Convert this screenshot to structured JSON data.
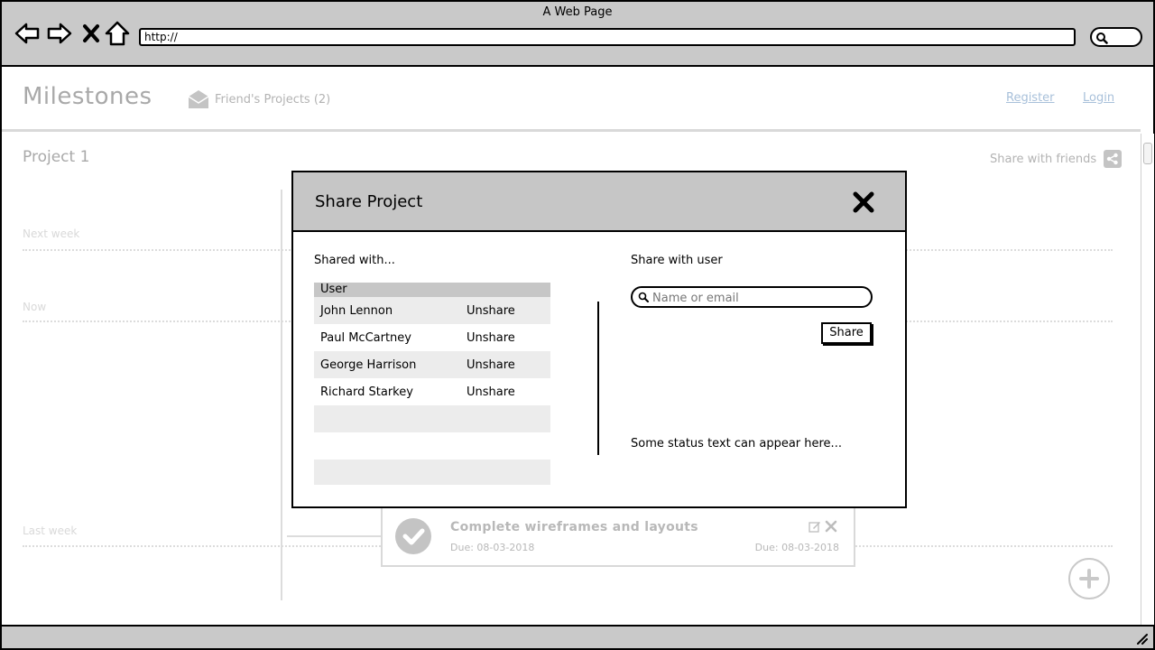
{
  "window": {
    "title": "A Web Page",
    "url": "http://"
  },
  "app": {
    "brand": "Milestones",
    "friends_projects": "Friend's Projects (2)",
    "register": "Register",
    "login": "Login"
  },
  "project": {
    "title": "Project 1",
    "share_with_friends": "Share with friends",
    "timeline_labels": {
      "next_week": "Next week",
      "now": "Now",
      "last_week": "Last week"
    }
  },
  "task": {
    "title": "Complete wireframes and layouts",
    "due_left": "Due: 08-03-2018",
    "due_right": "Due: 08-03-2018"
  },
  "modal": {
    "title": "Share Project",
    "shared_with_label": "Shared with...",
    "table_header": "User",
    "users": [
      {
        "name": "John Lennon",
        "action": "Unshare"
      },
      {
        "name": "Paul McCartney",
        "action": "Unshare"
      },
      {
        "name": "George Harrison",
        "action": "Unshare"
      },
      {
        "name": "Richard Starkey",
        "action": "Unshare"
      }
    ],
    "share_with_user_label": "Share with user",
    "search_placeholder": "Name or email",
    "share_button": "Share",
    "status_text": "Some status text can appear here..."
  }
}
